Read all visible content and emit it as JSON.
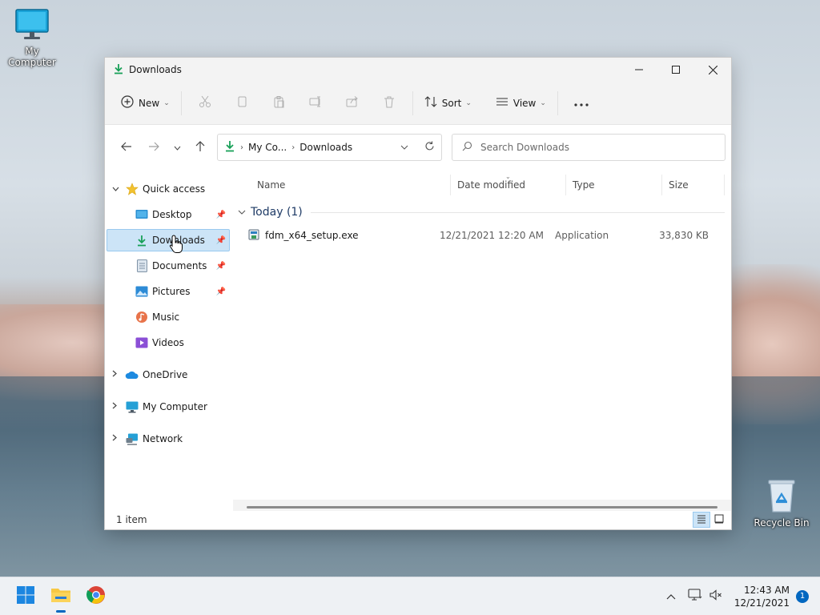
{
  "desktop": {
    "icons": [
      {
        "label": "My Computer",
        "icon": "monitor-icon"
      },
      {
        "label": "Recycle Bin",
        "icon": "recycle-bin-icon"
      }
    ]
  },
  "window": {
    "title": "Downloads",
    "toolbar": {
      "new_label": "New",
      "sort_label": "Sort",
      "view_label": "View",
      "icons": [
        "cut-icon",
        "copy-icon",
        "paste-icon",
        "rename-icon",
        "share-icon",
        "delete-icon",
        "more-icon"
      ]
    },
    "address": {
      "segments": [
        "My Co...",
        "Downloads"
      ]
    },
    "search": {
      "placeholder": "Search Downloads"
    },
    "sidebar": {
      "quick_access": "Quick access",
      "items": [
        {
          "label": "Desktop",
          "icon": "desktop-icon",
          "pinned": true
        },
        {
          "label": "Downloads",
          "icon": "downloads-icon",
          "pinned": true,
          "selected": true
        },
        {
          "label": "Documents",
          "icon": "documents-icon",
          "pinned": true
        },
        {
          "label": "Pictures",
          "icon": "pictures-icon",
          "pinned": true
        },
        {
          "label": "Music",
          "icon": "music-icon",
          "pinned": false
        },
        {
          "label": "Videos",
          "icon": "videos-icon",
          "pinned": false
        }
      ],
      "roots": [
        {
          "label": "OneDrive",
          "icon": "onedrive-icon"
        },
        {
          "label": "My Computer",
          "icon": "computer-icon"
        },
        {
          "label": "Network",
          "icon": "network-icon"
        }
      ]
    },
    "columns": {
      "name": "Name",
      "date": "Date modified",
      "type": "Type",
      "size": "Size"
    },
    "group": {
      "title": "Today (1)"
    },
    "files": [
      {
        "name": "fdm_x64_setup.exe",
        "date": "12/21/2021 12:20 AM",
        "type": "Application",
        "size": "33,830 KB"
      }
    ],
    "status": {
      "count": "1 item"
    }
  },
  "taskbar": {
    "apps": [
      "start-icon",
      "file-explorer-icon",
      "chrome-icon"
    ],
    "clock": {
      "time": "12:43 AM",
      "date": "12/21/2021"
    },
    "notifications": "1"
  }
}
